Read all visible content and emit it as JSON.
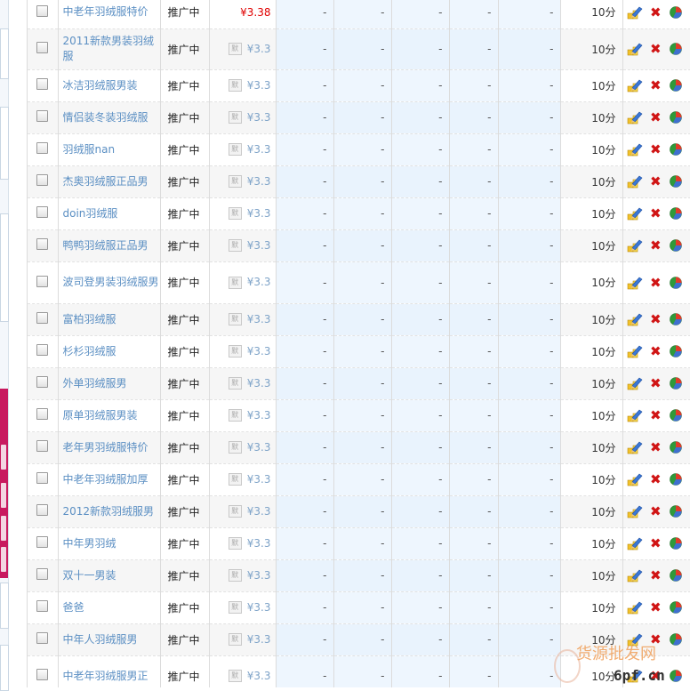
{
  "table": {
    "rows": [
      {
        "keyword": "中老年羽绒服特价",
        "status": "推广中",
        "price": "¥3.38",
        "default_price": false,
        "c1": "-",
        "c2": "-",
        "c3": "-",
        "c4": "-",
        "c5": "-",
        "time": "10分"
      },
      {
        "keyword": "2011新款男装羽绒服",
        "status": "推广中",
        "price": "¥3.3",
        "default_price": true,
        "c1": "-",
        "c2": "-",
        "c3": "-",
        "c4": "-",
        "c5": "-",
        "time": "10分"
      },
      {
        "keyword": "冰洁羽绒服男装",
        "status": "推广中",
        "price": "¥3.3",
        "default_price": true,
        "c1": "-",
        "c2": "-",
        "c3": "-",
        "c4": "-",
        "c5": "-",
        "time": "10分"
      },
      {
        "keyword": "情侣装冬装羽绒服",
        "status": "推广中",
        "price": "¥3.3",
        "default_price": true,
        "c1": "-",
        "c2": "-",
        "c3": "-",
        "c4": "-",
        "c5": "-",
        "time": "10分"
      },
      {
        "keyword": "羽绒服nan",
        "status": "推广中",
        "price": "¥3.3",
        "default_price": true,
        "c1": "-",
        "c2": "-",
        "c3": "-",
        "c4": "-",
        "c5": "-",
        "time": "10分"
      },
      {
        "keyword": "杰奥羽绒服正品男",
        "status": "推广中",
        "price": "¥3.3",
        "default_price": true,
        "c1": "-",
        "c2": "-",
        "c3": "-",
        "c4": "-",
        "c5": "-",
        "time": "10分"
      },
      {
        "keyword": "doin羽绒服",
        "status": "推广中",
        "price": "¥3.3",
        "default_price": true,
        "c1": "-",
        "c2": "-",
        "c3": "-",
        "c4": "-",
        "c5": "-",
        "time": "10分"
      },
      {
        "keyword": "鸭鸭羽绒服正品男",
        "status": "推广中",
        "price": "¥3.3",
        "default_price": true,
        "c1": "-",
        "c2": "-",
        "c3": "-",
        "c4": "-",
        "c5": "-",
        "time": "10分"
      },
      {
        "keyword": "波司登男装羽绒服男",
        "status": "推广中",
        "price": "¥3.3",
        "default_price": true,
        "c1": "-",
        "c2": "-",
        "c3": "-",
        "c4": "-",
        "c5": "-",
        "time": "10分"
      },
      {
        "keyword": "富柏羽绒服",
        "status": "推广中",
        "price": "¥3.3",
        "default_price": true,
        "c1": "-",
        "c2": "-",
        "c3": "-",
        "c4": "-",
        "c5": "-",
        "time": "10分"
      },
      {
        "keyword": "杉杉羽绒服",
        "status": "推广中",
        "price": "¥3.3",
        "default_price": true,
        "c1": "-",
        "c2": "-",
        "c3": "-",
        "c4": "-",
        "c5": "-",
        "time": "10分"
      },
      {
        "keyword": "外单羽绒服男",
        "status": "推广中",
        "price": "¥3.3",
        "default_price": true,
        "c1": "-",
        "c2": "-",
        "c3": "-",
        "c4": "-",
        "c5": "-",
        "time": "10分"
      },
      {
        "keyword": "原单羽绒服男装",
        "status": "推广中",
        "price": "¥3.3",
        "default_price": true,
        "c1": "-",
        "c2": "-",
        "c3": "-",
        "c4": "-",
        "c5": "-",
        "time": "10分"
      },
      {
        "keyword": "老年男羽绒服特价",
        "status": "推广中",
        "price": "¥3.3",
        "default_price": true,
        "c1": "-",
        "c2": "-",
        "c3": "-",
        "c4": "-",
        "c5": "-",
        "time": "10分"
      },
      {
        "keyword": "中老年羽绒服加厚",
        "status": "推广中",
        "price": "¥3.3",
        "default_price": true,
        "c1": "-",
        "c2": "-",
        "c3": "-",
        "c4": "-",
        "c5": "-",
        "time": "10分"
      },
      {
        "keyword": "2012新款羽绒服男",
        "status": "推广中",
        "price": "¥3.3",
        "default_price": true,
        "c1": "-",
        "c2": "-",
        "c3": "-",
        "c4": "-",
        "c5": "-",
        "time": "10分"
      },
      {
        "keyword": "中年男羽绒",
        "status": "推广中",
        "price": "¥3.3",
        "default_price": true,
        "c1": "-",
        "c2": "-",
        "c3": "-",
        "c4": "-",
        "c5": "-",
        "time": "10分"
      },
      {
        "keyword": "双十一男装",
        "status": "推广中",
        "price": "¥3.3",
        "default_price": true,
        "c1": "-",
        "c2": "-",
        "c3": "-",
        "c4": "-",
        "c5": "-",
        "time": "10分"
      },
      {
        "keyword": "爸爸",
        "status": "推广中",
        "price": "¥3.3",
        "default_price": true,
        "c1": "-",
        "c2": "-",
        "c3": "-",
        "c4": "-",
        "c5": "-",
        "time": "10分"
      },
      {
        "keyword": "中年人羽绒服男",
        "status": "推广中",
        "price": "¥3.3",
        "default_price": true,
        "c1": "-",
        "c2": "-",
        "c3": "-",
        "c4": "-",
        "c5": "-",
        "time": "10分"
      },
      {
        "keyword": "中老年羽绒服男正",
        "status": "推广中",
        "price": "¥3.3",
        "default_price": true,
        "c1": "-",
        "c2": "-",
        "c3": "-",
        "c4": "-",
        "c5": "-",
        "time": "10分"
      }
    ],
    "default_badge": "默",
    "icons": {
      "edit": "edit-pencil-icon",
      "delete": "delete-x-icon",
      "report": "report-pie-icon"
    },
    "colors": {
      "keyword_link": "#5b8fc3",
      "price_default": "#7ea3c8",
      "price_custom": "#e00000",
      "data_column_bg": "#eef6fe",
      "delete_red": "#d01515"
    }
  },
  "watermark": {
    "title": "货源批发网",
    "domain": "6pf.cn"
  }
}
